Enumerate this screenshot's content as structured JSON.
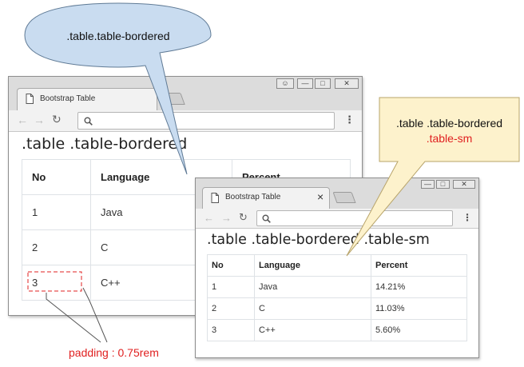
{
  "colors": {
    "bubble_blue": "#c9dcf0",
    "bubble_yellow": "#fdf2cc",
    "annotation_red": "#e02020"
  },
  "window_large": {
    "tab_title": "Bootstrap Table",
    "page_icon": "page-icon",
    "heading": ".table .table-bordered",
    "columns": [
      "No",
      "Language",
      "Percent"
    ],
    "rows": [
      [
        "1",
        "Java",
        ""
      ],
      [
        "2",
        "C",
        ""
      ],
      [
        "3",
        "C++",
        ""
      ]
    ]
  },
  "window_small": {
    "tab_title": "Bootstrap Table",
    "close_glyph": "×",
    "page_icon": "page-icon",
    "heading": ".table .table-bordered .table-sm",
    "columns": [
      "No",
      "Language",
      "Percent"
    ],
    "rows": [
      [
        "1",
        "Java",
        "14.21%"
      ],
      [
        "2",
        "C",
        "11.03%"
      ],
      [
        "3",
        "C++",
        "5.60%"
      ]
    ]
  },
  "callouts": {
    "blue_bubble": ".table.table-bordered",
    "yellow_line1": ".table .table-bordered",
    "yellow_line2": ".table-sm",
    "padding_note": "padding : 0.75rem"
  }
}
